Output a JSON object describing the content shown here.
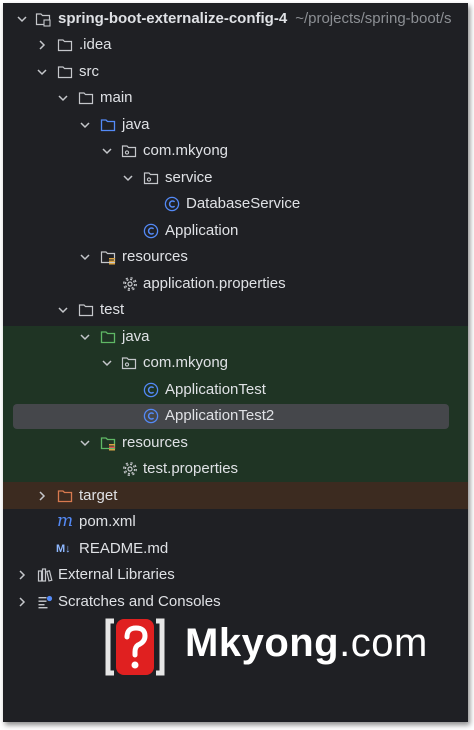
{
  "tree": {
    "project_name": "spring-boot-externalize-config-4",
    "project_path": "~/projects/spring-boot/s",
    "idea": ".idea",
    "src": "src",
    "main": "main",
    "main_java": "java",
    "main_pkg": "com.mkyong",
    "service": "service",
    "database_service": "DatabaseService",
    "application": "Application",
    "main_resources": "resources",
    "app_properties": "application.properties",
    "test": "test",
    "test_java": "java",
    "test_pkg": "com.mkyong",
    "application_test": "ApplicationTest",
    "application_test2": "ApplicationTest2",
    "test_resources": "resources",
    "test_properties": "test.properties",
    "target": "target",
    "pom": "pom.xml",
    "readme": "README.md",
    "external_libraries": "External Libraries",
    "scratches": "Scratches and Consoles"
  },
  "watermark": {
    "brand": "Mkyong",
    "domain": ".com"
  },
  "colors": {
    "background": "#1f2024",
    "test_sources_band": "#1f3424",
    "excluded_band": "#3c2b20",
    "selection": "#45474b",
    "class_icon": "#548af7",
    "source_folder_blue": "#548af7",
    "test_folder_green": "#5fb865",
    "resources_yellow": "#d9a343",
    "target_folder": "#d97a4f",
    "watermark_red": "#e02020"
  },
  "icons": {
    "project": "project-folder-icon",
    "folder": "folder-icon",
    "package": "package-icon",
    "class": "class-icon",
    "properties": "gear-icon",
    "maven": "maven-icon",
    "markdown": "markdown-icon",
    "libraries": "libraries-icon",
    "scratches": "scratches-icon"
  }
}
